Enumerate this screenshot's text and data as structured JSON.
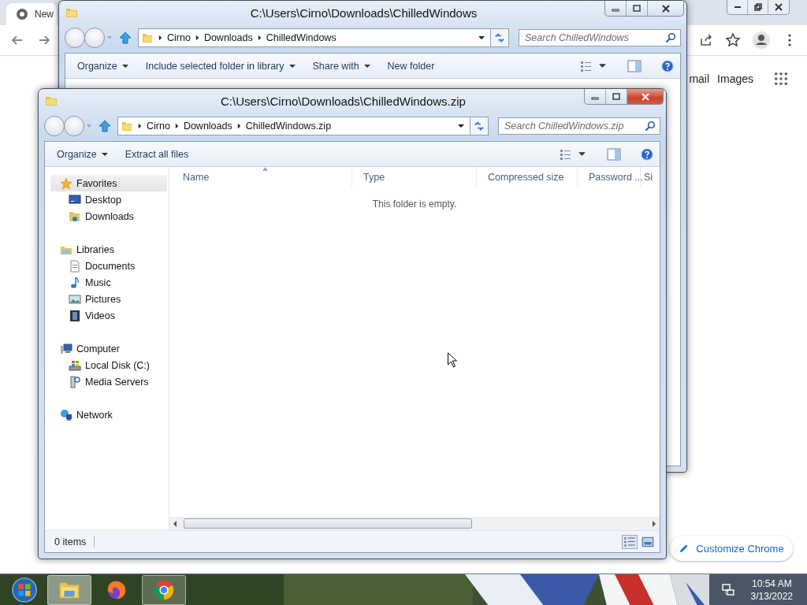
{
  "browser": {
    "tab_title": "New",
    "links": [
      "mail",
      "Images"
    ],
    "customize_button": "Customize Chrome"
  },
  "windows": [
    {
      "title": "C:\\Users\\Cirno\\Downloads\\ChilledWindows",
      "active": false,
      "breadcrumbs": [
        "Cirno",
        "Downloads",
        "ChilledWindows"
      ],
      "search": {
        "placeholder": "Search ChilledWindows"
      },
      "toolbar": [
        {
          "label": "Organize",
          "dropdown": true
        },
        {
          "label": "Include selected folder in library",
          "dropdown": true
        },
        {
          "label": "Share with",
          "dropdown": true
        },
        {
          "label": "New folder",
          "dropdown": false
        }
      ]
    },
    {
      "title": "C:\\Users\\Cirno\\Downloads\\ChilledWindows.zip",
      "active": true,
      "breadcrumbs": [
        "Cirno",
        "Downloads",
        "ChilledWindows.zip"
      ],
      "search": {
        "placeholder": "Search ChilledWindows.zip"
      },
      "toolbar": [
        {
          "label": "Organize",
          "dropdown": true
        },
        {
          "label": "Extract all files",
          "dropdown": false
        }
      ],
      "sidebar": [
        {
          "label": "Favorites",
          "kind": "favorites",
          "selected": true,
          "children": [
            {
              "label": "Desktop",
              "kind": "desktop",
              "selected": false
            },
            {
              "label": "Downloads",
              "kind": "downloads",
              "selected": false
            }
          ]
        },
        {
          "label": "Libraries",
          "kind": "libraries",
          "selected": false,
          "children": [
            {
              "label": "Documents",
              "kind": "documents",
              "selected": false
            },
            {
              "label": "Music",
              "kind": "music",
              "selected": false
            },
            {
              "label": "Pictures",
              "kind": "pictures",
              "selected": false
            },
            {
              "label": "Videos",
              "kind": "videos",
              "selected": false
            }
          ]
        },
        {
          "label": "Computer",
          "kind": "computer",
          "selected": false,
          "children": [
            {
              "label": "Local Disk (C:)",
              "kind": "disk",
              "selected": false
            },
            {
              "label": "Media Servers",
              "kind": "media",
              "selected": false
            }
          ]
        },
        {
          "label": "Network",
          "kind": "network",
          "selected": false
        }
      ],
      "columns": [
        {
          "label": "Name",
          "sorted": true
        },
        {
          "label": "Type",
          "sorted": false
        },
        {
          "label": "Compressed size",
          "sorted": false
        },
        {
          "label": "Password ...",
          "sorted": false
        },
        {
          "label": "Si",
          "sorted": false
        }
      ],
      "empty_message": "This folder is empty.",
      "status": "0 items"
    }
  ],
  "taskbar": {
    "apps": [
      {
        "kind": "explorer",
        "running": true
      },
      {
        "kind": "firefox",
        "running": false
      },
      {
        "kind": "chrome",
        "running": true
      }
    ],
    "clock": {
      "time": "10:54 AM",
      "date": "3/13/2022"
    }
  }
}
